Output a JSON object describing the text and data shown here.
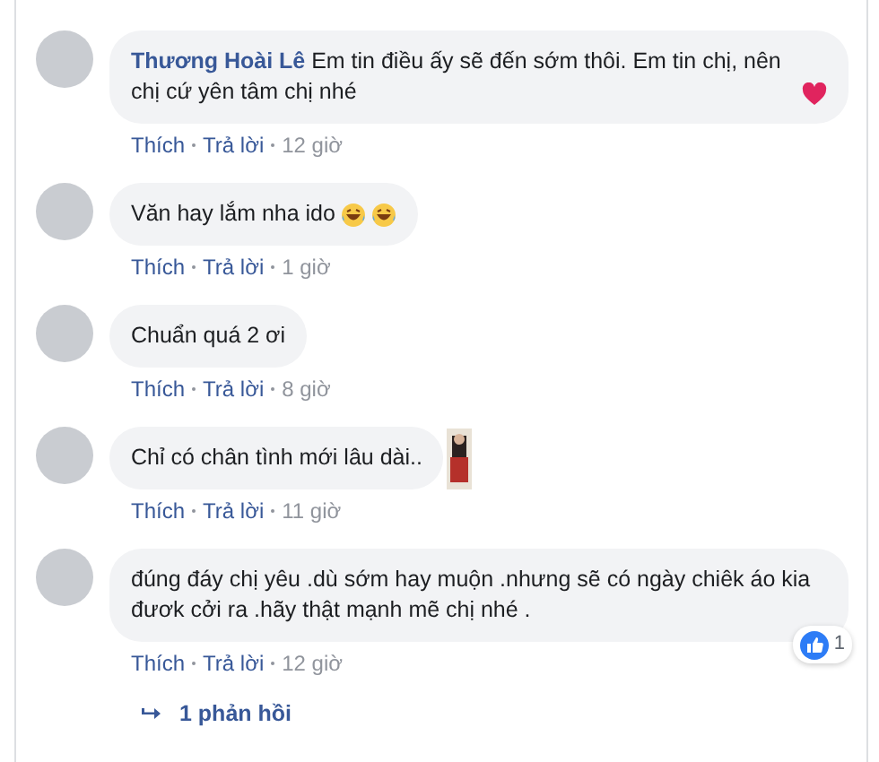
{
  "comments": [
    {
      "name": "Thương Hoài Lê",
      "text": "Em tin điều ấy sẽ đến sớm thôi. Em tin chị, nên chị cứ yên tâm chị nhé",
      "emoji": [
        {
          "kind": "heart"
        }
      ],
      "like": "Thích",
      "reply": "Trả lời",
      "time": "12 giờ"
    },
    {
      "text": "Văn hay lắm nha ido",
      "emoji": [
        {
          "kind": "laugh"
        },
        {
          "kind": "laugh"
        }
      ],
      "like": "Thích",
      "reply": "Trả lời",
      "time": "1 giờ"
    },
    {
      "text": "Chuẩn quá 2 ơi",
      "like": "Thích",
      "reply": "Trả lời",
      "time": "8 giờ"
    },
    {
      "text": "Chỉ có chân tình mới lâu dài..",
      "like": "Thích",
      "reply": "Trả lời",
      "time": "11 giờ"
    },
    {
      "text": "đúng đáy chị yêu .dù sớm hay muộn .nhưng sẽ có ngày chiêk áo kia đươk cởi ra .hãy thật mạnh mẽ chị nhé .",
      "reaction": {
        "kind": "like",
        "count": "1"
      },
      "like": "Thích",
      "reply": "Trả lời",
      "time": "12 giờ"
    }
  ],
  "replies_link": "1 phản hồi"
}
